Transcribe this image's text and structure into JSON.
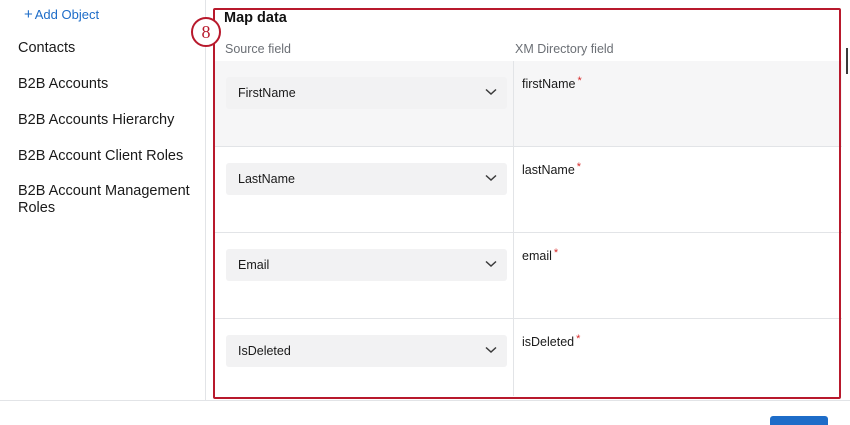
{
  "sidebar": {
    "add_object_label": "Add Object",
    "items": [
      {
        "label": "Contacts"
      },
      {
        "label": "B2B Accounts"
      },
      {
        "label": "B2B Accounts Hierarchy"
      },
      {
        "label": "B2B Account Client Roles"
      },
      {
        "label": "B2B Account Management Roles"
      }
    ]
  },
  "main": {
    "title": "Map data",
    "step_number": "8",
    "columns": {
      "source": "Source field",
      "target": "XM Directory field"
    },
    "mappings": [
      {
        "source": "FirstName",
        "target": "firstName",
        "required": "*"
      },
      {
        "source": "LastName",
        "target": "lastName",
        "required": "*"
      },
      {
        "source": "Email",
        "target": "email",
        "required": "*"
      },
      {
        "source": "IsDeleted",
        "target": "isDeleted",
        "required": "*"
      }
    ]
  },
  "colors": {
    "accent": "#1d6cc8",
    "highlight": "#b8192c",
    "required": "#d62b2b"
  }
}
